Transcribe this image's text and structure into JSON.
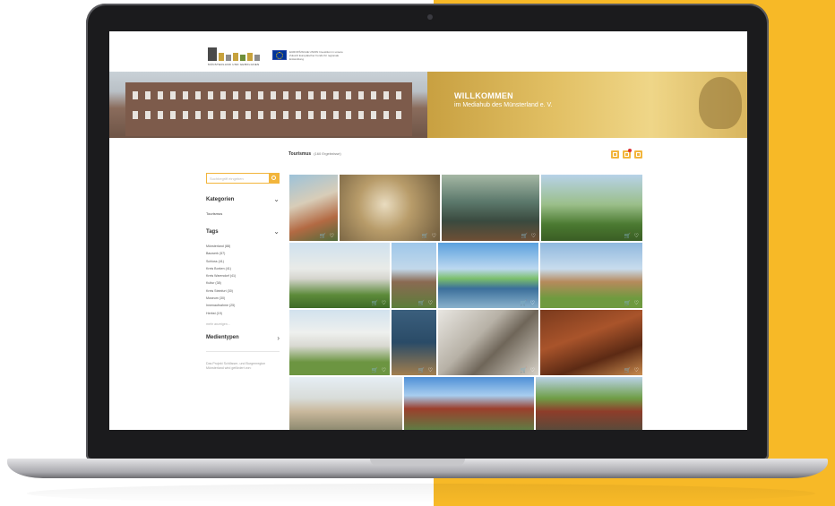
{
  "header": {
    "logo_caption": "MÜNSTERLAND UND GEBOLGNEN",
    "logo_colors": [
      "#4a4a4a",
      "#c7a23d",
      "#8b8b8b",
      "#c7a23d",
      "#6e8e3a",
      "#c7a23d",
      "#8b8b8b"
    ],
    "eu_text": "EUROPÄISCHE UNION Investition in unsere Zukunft Europäischer Fonds für regionale Entwicklung"
  },
  "hero": {
    "title": "WILLKOMMEN",
    "subtitle": "im Mediahub des Münsterland e. V."
  },
  "toolbar": {
    "title": "Tourismus",
    "count": "(160 Ergebnisse)"
  },
  "sidebar": {
    "search_placeholder": "Suchbegriff eingeben",
    "categories_heading": "Kategorien",
    "category_item": "Tourismus",
    "tags_heading": "Tags",
    "tags": [
      "Münsterland (88)",
      "Bauwerk (57)",
      "Schloss (41)",
      "Kreis Borken (41)",
      "Kreis Warendorf (41)",
      "Kultur (38)",
      "Kreis Steinfurt (30)",
      "Museum (30)",
      "Innenaufnahme (25)",
      "Herbst (19)"
    ],
    "show_more": "mehr anzeigen...",
    "media_types_heading": "Medientypen",
    "footer_text": "Das Projekt Schlösser- und Burgenregion Münsterland wird gefördert von:"
  },
  "colors": {
    "accent": "#f2b53c",
    "background_yellow": "#f7b927"
  },
  "grid": {
    "tile_icons": "🛒 ♡",
    "tiles": [
      {
        "name": "castle-brick"
      },
      {
        "name": "chandelier-hall"
      },
      {
        "name": "ornate-room"
      },
      {
        "name": "park-castle"
      },
      {
        "name": "white-manor"
      },
      {
        "name": "church-tower"
      },
      {
        "name": "lake-pier"
      },
      {
        "name": "country-house"
      },
      {
        "name": "white-palace"
      },
      {
        "name": "blue-room"
      },
      {
        "name": "silver-instrument"
      },
      {
        "name": "wooden-cabinet"
      },
      {
        "name": "monastery"
      },
      {
        "name": "red-buildings"
      },
      {
        "name": "brick-street"
      }
    ]
  }
}
